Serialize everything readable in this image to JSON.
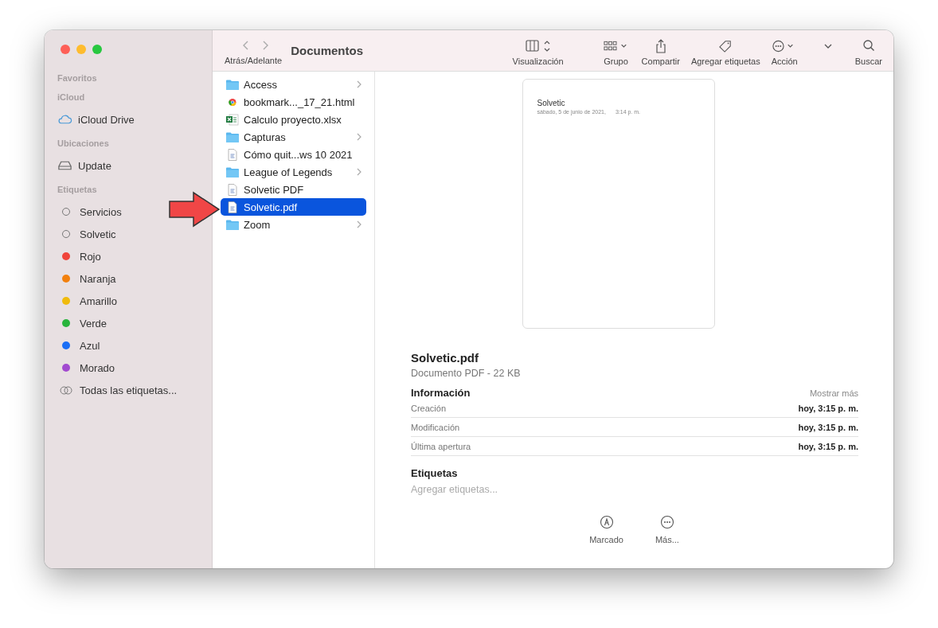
{
  "window": {
    "title": "Documentos",
    "nav_label": "Atrás/Adelante"
  },
  "toolbar": [
    {
      "kind": "view",
      "label": "Visualización"
    },
    {
      "kind": "group",
      "label": "Grupo"
    },
    {
      "kind": "share",
      "label": "Compartir"
    },
    {
      "kind": "tag",
      "label": "Agregar etiquetas"
    },
    {
      "kind": "action",
      "label": "Acción"
    },
    {
      "kind": "more"
    },
    {
      "kind": "search",
      "label": "Buscar"
    }
  ],
  "sidebar": [
    {
      "heading": "Favoritos"
    },
    {
      "heading": "iCloud",
      "items": [
        {
          "kind": "cloud",
          "label": "iCloud Drive"
        }
      ]
    },
    {
      "heading": "Ubicaciones",
      "items": [
        {
          "kind": "disk",
          "label": "Update"
        }
      ]
    },
    {
      "heading": "Etiquetas",
      "items": [
        {
          "kind": "outline",
          "label": "Servicios"
        },
        {
          "kind": "outline",
          "label": "Solvetic"
        },
        {
          "kind": "tag",
          "label": "Rojo",
          "color": "#f0443a"
        },
        {
          "kind": "tag",
          "label": "Naranja",
          "color": "#f2800d"
        },
        {
          "kind": "tag",
          "label": "Amarillo",
          "color": "#f0bb0c"
        },
        {
          "kind": "tag",
          "label": "Verde",
          "color": "#28b43c"
        },
        {
          "kind": "tag",
          "label": "Azul",
          "color": "#1a6ef5"
        },
        {
          "kind": "tag",
          "label": "Morado",
          "color": "#a24ad0"
        },
        {
          "kind": "all",
          "label": "Todas las etiquetas..."
        }
      ]
    }
  ],
  "files": [
    {
      "kind": "folder",
      "name": "Access",
      "selected": false
    },
    {
      "kind": "web",
      "name": "bookmark..._17_21.html",
      "selected": false
    },
    {
      "kind": "sheet",
      "name": "Calculo proyecto.xlsx",
      "selected": false
    },
    {
      "kind": "folder",
      "name": "Capturas",
      "selected": false
    },
    {
      "kind": "doc",
      "name": "Cómo quit...ws 10 2021",
      "selected": false
    },
    {
      "kind": "folder",
      "name": "League of Legends",
      "selected": false
    },
    {
      "kind": "doc",
      "name": "Solvetic PDF",
      "selected": false
    },
    {
      "kind": "doc",
      "name": "Solvetic.pdf",
      "selected": true
    },
    {
      "kind": "folder",
      "name": "Zoom",
      "selected": false
    }
  ],
  "preview": {
    "doc_title": "Solvetic",
    "doc_date": "sábado, 5 de junio de 2021,",
    "doc_time": "3:14 p. m.",
    "name": "Solvetic.pdf",
    "kind": "Documento PDF - 22 KB",
    "info_heading": "Información",
    "show_more": "Mostrar más",
    "info": [
      {
        "label": "Creación",
        "value": "hoy, 3:15 p. m."
      },
      {
        "label": "Modificación",
        "value": "hoy, 3:15 p. m."
      },
      {
        "label": "Última apertura",
        "value": "hoy, 3:15 p. m."
      }
    ],
    "tags_heading": "Etiquetas",
    "tags_placeholder": "Agregar etiquetas...",
    "actions": [
      {
        "kind": "markup",
        "label": "Marcado"
      },
      {
        "kind": "more",
        "label": "Más..."
      }
    ]
  }
}
